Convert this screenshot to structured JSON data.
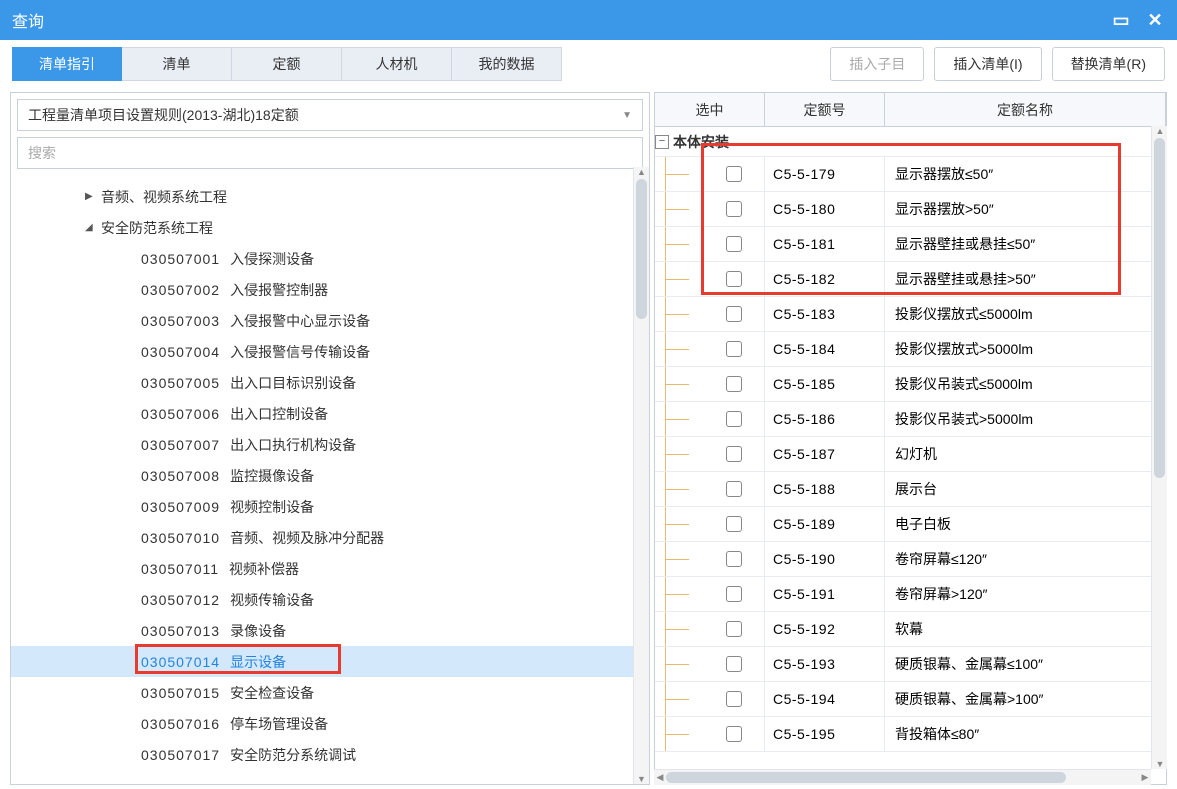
{
  "window": {
    "title": "查询"
  },
  "tabs": [
    "清单指引",
    "清单",
    "定额",
    "人材机",
    "我的数据"
  ],
  "buttons": {
    "insert_child": "插入子目",
    "insert_list": "插入清单(I)",
    "replace_list": "替换清单(R)"
  },
  "dropdown": {
    "value": "工程量清单项目设置规则(2013-湖北)18定额"
  },
  "search": {
    "placeholder": "搜索"
  },
  "tree": {
    "cat1": {
      "label": "音频、视频系统工程",
      "caret": "▶"
    },
    "cat2": {
      "label": "安全防范系统工程",
      "caret": "◢"
    },
    "items": [
      {
        "code": "030507001",
        "name": "入侵探测设备"
      },
      {
        "code": "030507002",
        "name": "入侵报警控制器"
      },
      {
        "code": "030507003",
        "name": "入侵报警中心显示设备"
      },
      {
        "code": "030507004",
        "name": "入侵报警信号传输设备"
      },
      {
        "code": "030507005",
        "name": "出入口目标识别设备"
      },
      {
        "code": "030507006",
        "name": "出入口控制设备"
      },
      {
        "code": "030507007",
        "name": "出入口执行机构设备"
      },
      {
        "code": "030507008",
        "name": "监控摄像设备"
      },
      {
        "code": "030507009",
        "name": "视频控制设备"
      },
      {
        "code": "030507010",
        "name": "音频、视频及脉冲分配器"
      },
      {
        "code": "030507011",
        "name": "视频补偿器"
      },
      {
        "code": "030507012",
        "name": "视频传输设备"
      },
      {
        "code": "030507013",
        "name": "录像设备"
      },
      {
        "code": "030507014",
        "name": "显示设备"
      },
      {
        "code": "030507015",
        "name": "安全检查设备"
      },
      {
        "code": "030507016",
        "name": "停车场管理设备"
      },
      {
        "code": "030507017",
        "name": "安全防范分系统调试"
      }
    ]
  },
  "grid": {
    "headers": {
      "sel": "选中",
      "code": "定额号",
      "name": "定额名称"
    },
    "section": "本体安装",
    "rows": [
      {
        "code": "C5-5-179",
        "name": "显示器摆放≤50″"
      },
      {
        "code": "C5-5-180",
        "name": "显示器摆放>50″"
      },
      {
        "code": "C5-5-181",
        "name": "显示器壁挂或悬挂≤50″"
      },
      {
        "code": "C5-5-182",
        "name": "显示器壁挂或悬挂>50″"
      },
      {
        "code": "C5-5-183",
        "name": "投影仪摆放式≤5000lm"
      },
      {
        "code": "C5-5-184",
        "name": "投影仪摆放式>5000lm"
      },
      {
        "code": "C5-5-185",
        "name": "投影仪吊装式≤5000lm"
      },
      {
        "code": "C5-5-186",
        "name": "投影仪吊装式>5000lm"
      },
      {
        "code": "C5-5-187",
        "name": "幻灯机"
      },
      {
        "code": "C5-5-188",
        "name": "展示台"
      },
      {
        "code": "C5-5-189",
        "name": "电子白板"
      },
      {
        "code": "C5-5-190",
        "name": "卷帘屏幕≤120″"
      },
      {
        "code": "C5-5-191",
        "name": "卷帘屏幕>120″"
      },
      {
        "code": "C5-5-192",
        "name": "软幕"
      },
      {
        "code": "C5-5-193",
        "name": "硬质银幕、金属幕≤100″"
      },
      {
        "code": "C5-5-194",
        "name": "硬质银幕、金属幕>100″"
      },
      {
        "code": "C5-5-195",
        "name": "背投箱体≤80″"
      }
    ]
  }
}
